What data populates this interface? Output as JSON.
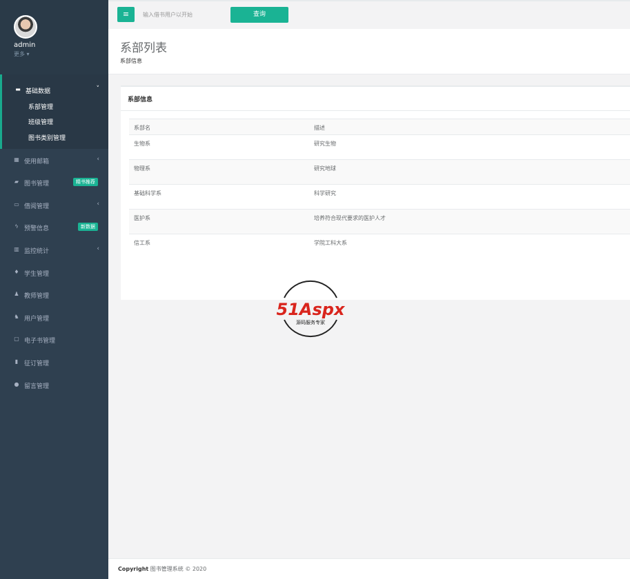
{
  "user": {
    "name": "admin",
    "more": "更多 ▾"
  },
  "sidebar": {
    "group": {
      "label": "基础数据",
      "arrow": "˅",
      "items": [
        "系部管理",
        "班级管理",
        "图书类别管理"
      ]
    },
    "items": [
      {
        "icon": "▦",
        "label": "使用邮箱",
        "arrow": "‹"
      },
      {
        "icon": "▰",
        "label": "图书管理",
        "badge": "精书推荐"
      },
      {
        "icon": "▭",
        "label": "借阅管理",
        "arrow": "‹"
      },
      {
        "icon": "ϟ",
        "label": "预警信息",
        "badge": "新数据"
      },
      {
        "icon": "▥",
        "label": "监控统计",
        "arrow": "‹"
      },
      {
        "icon": "♦",
        "label": "学生管理"
      },
      {
        "icon": "♟",
        "label": "教师管理"
      },
      {
        "icon": "♞",
        "label": "用户管理"
      },
      {
        "icon": "▢",
        "label": "电子书管理"
      },
      {
        "icon": "▮",
        "label": "征订管理"
      },
      {
        "icon": "●",
        "label": "留言管理"
      }
    ]
  },
  "topbar": {
    "menu_icon": "≡",
    "search_placeholder": "输入借书用户以开始",
    "query_label": "查询"
  },
  "header": {
    "title": "系部列表",
    "breadcrumb": "系部信息"
  },
  "card": {
    "title": "系部信息",
    "columns": [
      "系部名",
      "描述"
    ],
    "rows": [
      [
        "生物系",
        "研究生物"
      ],
      [
        "物理系",
        "研究地球"
      ],
      [
        "基础科学系",
        "科学研究"
      ],
      [
        "医护系",
        "培养符合现代要求的医护人才"
      ],
      [
        "信工系",
        "学院工科大系"
      ]
    ]
  },
  "watermark": {
    "logo": "51Aspx",
    "sub": "源码服务专家"
  },
  "footer": {
    "copyright": "Copyright",
    "text": "图书管理系统 © 2020"
  },
  "colors": {
    "accent": "#1ab394",
    "sidebar": "#2f4050",
    "logo_red": "#d9251d"
  }
}
